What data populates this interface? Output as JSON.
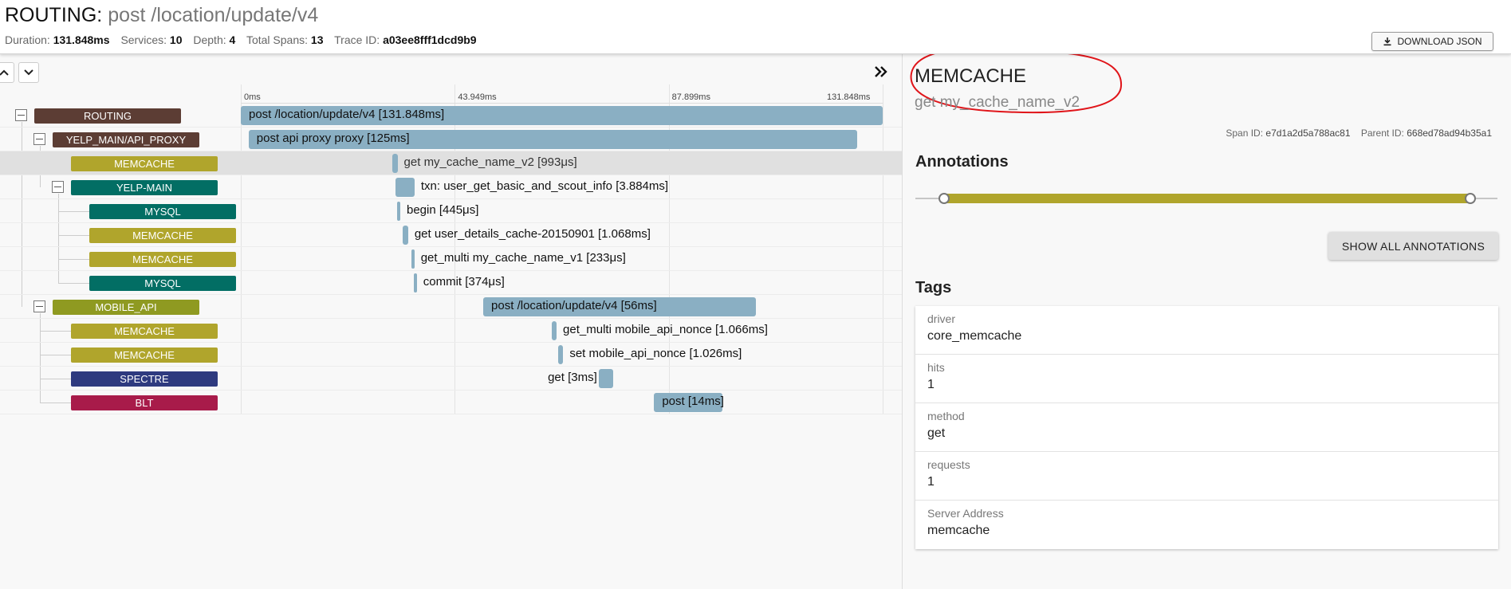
{
  "header": {
    "service": "ROUTING",
    "separator": ":",
    "span_name": "post /location/update/v4",
    "stats": {
      "duration_label": "Duration:",
      "duration": "131.848ms",
      "services_label": "Services:",
      "services": "10",
      "depth_label": "Depth:",
      "depth": "4",
      "total_spans_label": "Total Spans:",
      "total_spans": "13",
      "trace_id_label": "Trace ID:",
      "trace_id": "a03ee8fff1dcd9b9"
    },
    "download_label": "DOWNLOAD JSON"
  },
  "timeline": {
    "ticks": [
      {
        "label": "0ms",
        "value": 0
      },
      {
        "label": "43.949ms",
        "value": 43.949
      },
      {
        "label": "87.899ms",
        "value": 87.899
      },
      {
        "label": "131.848ms",
        "value": 131.848
      }
    ],
    "total_ms": 131.848,
    "spans": [
      {
        "service": "ROUTING",
        "label": "post /location/update/v4 [131.848ms]",
        "start_ms": 0,
        "duration_ms": 131.848,
        "depth": 0,
        "collapsible": true,
        "color": "#5c3d34"
      },
      {
        "service": "YELP_MAIN/API_PROXY",
        "label": "post api proxy proxy [125ms]",
        "start_ms": 1.6,
        "duration_ms": 125,
        "depth": 1,
        "collapsible": true,
        "color": "#5c3d34"
      },
      {
        "service": "MEMCACHE",
        "label": "get my_cache_name_v2 [993μs]",
        "start_ms": 31.2,
        "duration_ms": 0.993,
        "depth": 2,
        "collapsible": false,
        "color": "#b0a52c",
        "selected": true
      },
      {
        "service": "YELP-MAIN",
        "label": "txn: user_get_basic_and_scout_info [3.884ms]",
        "start_ms": 31.8,
        "duration_ms": 3.884,
        "depth": 2,
        "collapsible": true,
        "color": "#026e64"
      },
      {
        "service": "MYSQL",
        "label": "begin [445μs]",
        "start_ms": 32.1,
        "duration_ms": 0.445,
        "depth": 3,
        "collapsible": false,
        "color": "#026e64"
      },
      {
        "service": "MEMCACHE",
        "label": "get user_details_cache-20150901 [1.068ms]",
        "start_ms": 33.3,
        "duration_ms": 1.068,
        "depth": 3,
        "collapsible": false,
        "color": "#b0a52c"
      },
      {
        "service": "MEMCACHE",
        "label": "get_multi my_cache_name_v1 [233μs]",
        "start_ms": 35.0,
        "duration_ms": 0.233,
        "depth": 3,
        "collapsible": false,
        "color": "#b0a52c"
      },
      {
        "service": "MYSQL",
        "label": "commit [374μs]",
        "start_ms": 35.5,
        "duration_ms": 0.374,
        "depth": 3,
        "collapsible": false,
        "color": "#026e64"
      },
      {
        "service": "MOBILE_API",
        "label": "post /location/update/v4 [56ms]",
        "start_ms": 49.8,
        "duration_ms": 56,
        "depth": 1,
        "collapsible": true,
        "color": "#8f9a21"
      },
      {
        "service": "MEMCACHE",
        "label": "get_multi mobile_api_nonce [1.066ms]",
        "start_ms": 63.8,
        "duration_ms": 1.066,
        "depth": 2,
        "collapsible": false,
        "color": "#b0a52c"
      },
      {
        "service": "MEMCACHE",
        "label": "set mobile_api_nonce [1.026ms]",
        "start_ms": 65.2,
        "duration_ms": 1.026,
        "depth": 2,
        "collapsible": false,
        "color": "#b0a52c"
      },
      {
        "service": "SPECTRE",
        "label": "get [3ms]",
        "start_ms": 73.5,
        "duration_ms": 3,
        "depth": 2,
        "collapsible": false,
        "color": "#2e3a7f",
        "label_left": true
      },
      {
        "service": "BLT",
        "label": "post [14ms]",
        "start_ms": 84.9,
        "duration_ms": 14,
        "depth": 2,
        "collapsible": false,
        "color": "#a81b4a",
        "label_inside": true
      }
    ]
  },
  "detail": {
    "service": "MEMCACHE",
    "name": "get my_cache_name_v2",
    "span_id_label": "Span ID:",
    "span_id": "e7d1a2d5a788ac81",
    "parent_id_label": "Parent ID:",
    "parent_id": "668ed78ad94b35a1",
    "annotations_title": "Annotations",
    "show_all_label": "SHOW ALL ANNOTATIONS",
    "tags_title": "Tags",
    "tags": [
      {
        "key": "driver",
        "value": "core_memcache"
      },
      {
        "key": "hits",
        "value": "1"
      },
      {
        "key": "method",
        "value": "get"
      },
      {
        "key": "requests",
        "value": "1"
      },
      {
        "key": "Server Address",
        "value": "memcache"
      }
    ]
  }
}
